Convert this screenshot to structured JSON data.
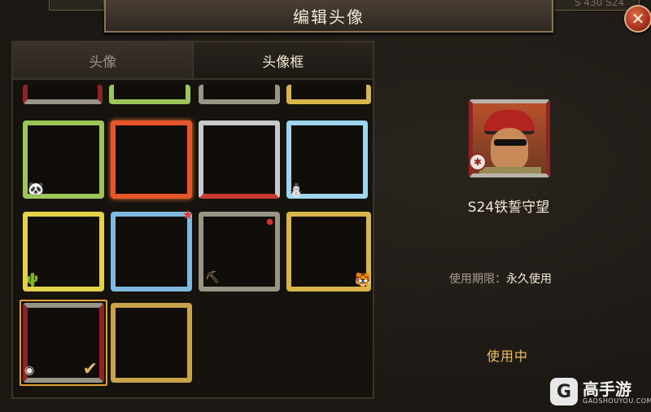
{
  "header": {
    "title": "编辑头像",
    "top_right_text": "S 430 S24"
  },
  "tabs": [
    {
      "label": "头像",
      "active": false
    },
    {
      "label": "头像框",
      "active": true
    }
  ],
  "frames": [
    {
      "theme": "bamboo-panda",
      "selected": false
    },
    {
      "theme": "fire-dragon",
      "selected": false
    },
    {
      "theme": "mech-red",
      "selected": false
    },
    {
      "theme": "snow-snowman",
      "selected": false
    },
    {
      "theme": "desert-cactus",
      "selected": false
    },
    {
      "theme": "ocean-wave",
      "selected": false
    },
    {
      "theme": "mine-pickaxe",
      "selected": false
    },
    {
      "theme": "jungle-tiger",
      "selected": false
    },
    {
      "theme": "s24-iron-oath",
      "selected": true
    },
    {
      "theme": "golden-dragon",
      "selected": false
    }
  ],
  "detail": {
    "frame_name": "S24铁誓守望",
    "usage_label": "使用期限：",
    "usage_value": "永久使用",
    "status": "使用中"
  },
  "watermark": {
    "name": "高手游",
    "url": "GAOSHOUYOU.COM"
  },
  "colors": {
    "accent": "#f0c05c",
    "selected_border": "#e0a037",
    "header_border": "#8a7457"
  }
}
